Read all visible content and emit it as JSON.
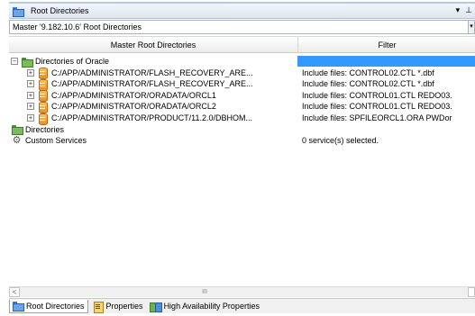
{
  "panel": {
    "title": "Root Directories",
    "pin_glyph": "▾",
    "pin2_glyph": "⊥"
  },
  "master_combo": {
    "value": "Master '9.182.10.6' Root Directories"
  },
  "columns": {
    "name": "Master Root Directories",
    "filter": "Filter"
  },
  "tree": [
    {
      "label": "Directories of Oracle",
      "filter": "",
      "icon": "folder-icon",
      "expander": "−",
      "indent": 0,
      "selected": true
    },
    {
      "label": "C:/APP/ADMINISTRATOR/FLASH_RECOVERY_ARE...",
      "filter": "Include files: CONTROL02.CTL *.dbf",
      "icon": "database-icon",
      "expander": "+",
      "indent": 1
    },
    {
      "label": "C:/APP/ADMINISTRATOR/FLASH_RECOVERY_ARE...",
      "filter": "Include files: CONTROL02.CTL *.dbf",
      "icon": "database-icon",
      "expander": "+",
      "indent": 1
    },
    {
      "label": "C:/APP/ADMINISTRATOR/ORADATA/ORCL1",
      "filter": "Include files: CONTROL01.CTL REDO03.",
      "icon": "database-icon",
      "expander": "+",
      "indent": 1
    },
    {
      "label": "C:/APP/ADMINISTRATOR/ORADATA/ORCL2",
      "filter": "Include files: CONTROL01.CTL REDO03.",
      "icon": "database-icon",
      "expander": "+",
      "indent": 1
    },
    {
      "label": "C:/APP/ADMINISTRATOR/PRODUCT/11.2.0/DBHOM...",
      "filter": "Include files: SPFILEORCL1.ORA PWDor",
      "icon": "database-icon",
      "expander": "+",
      "indent": 1
    },
    {
      "label": "Directories",
      "filter": "",
      "icon": "folder-icon",
      "expander": "",
      "indent": 0
    },
    {
      "label": "Custom Services",
      "filter": "0 service(s) selected.",
      "icon": "gear-icon",
      "expander": "",
      "indent": 0
    }
  ],
  "scrollbar": {
    "left_arrow": "<",
    "thumb_grip": "III"
  },
  "tabs": [
    {
      "label": "Root Directories",
      "active": true
    },
    {
      "label": "Properties",
      "active": false
    },
    {
      "label": "High Availability Properties",
      "active": false
    }
  ]
}
